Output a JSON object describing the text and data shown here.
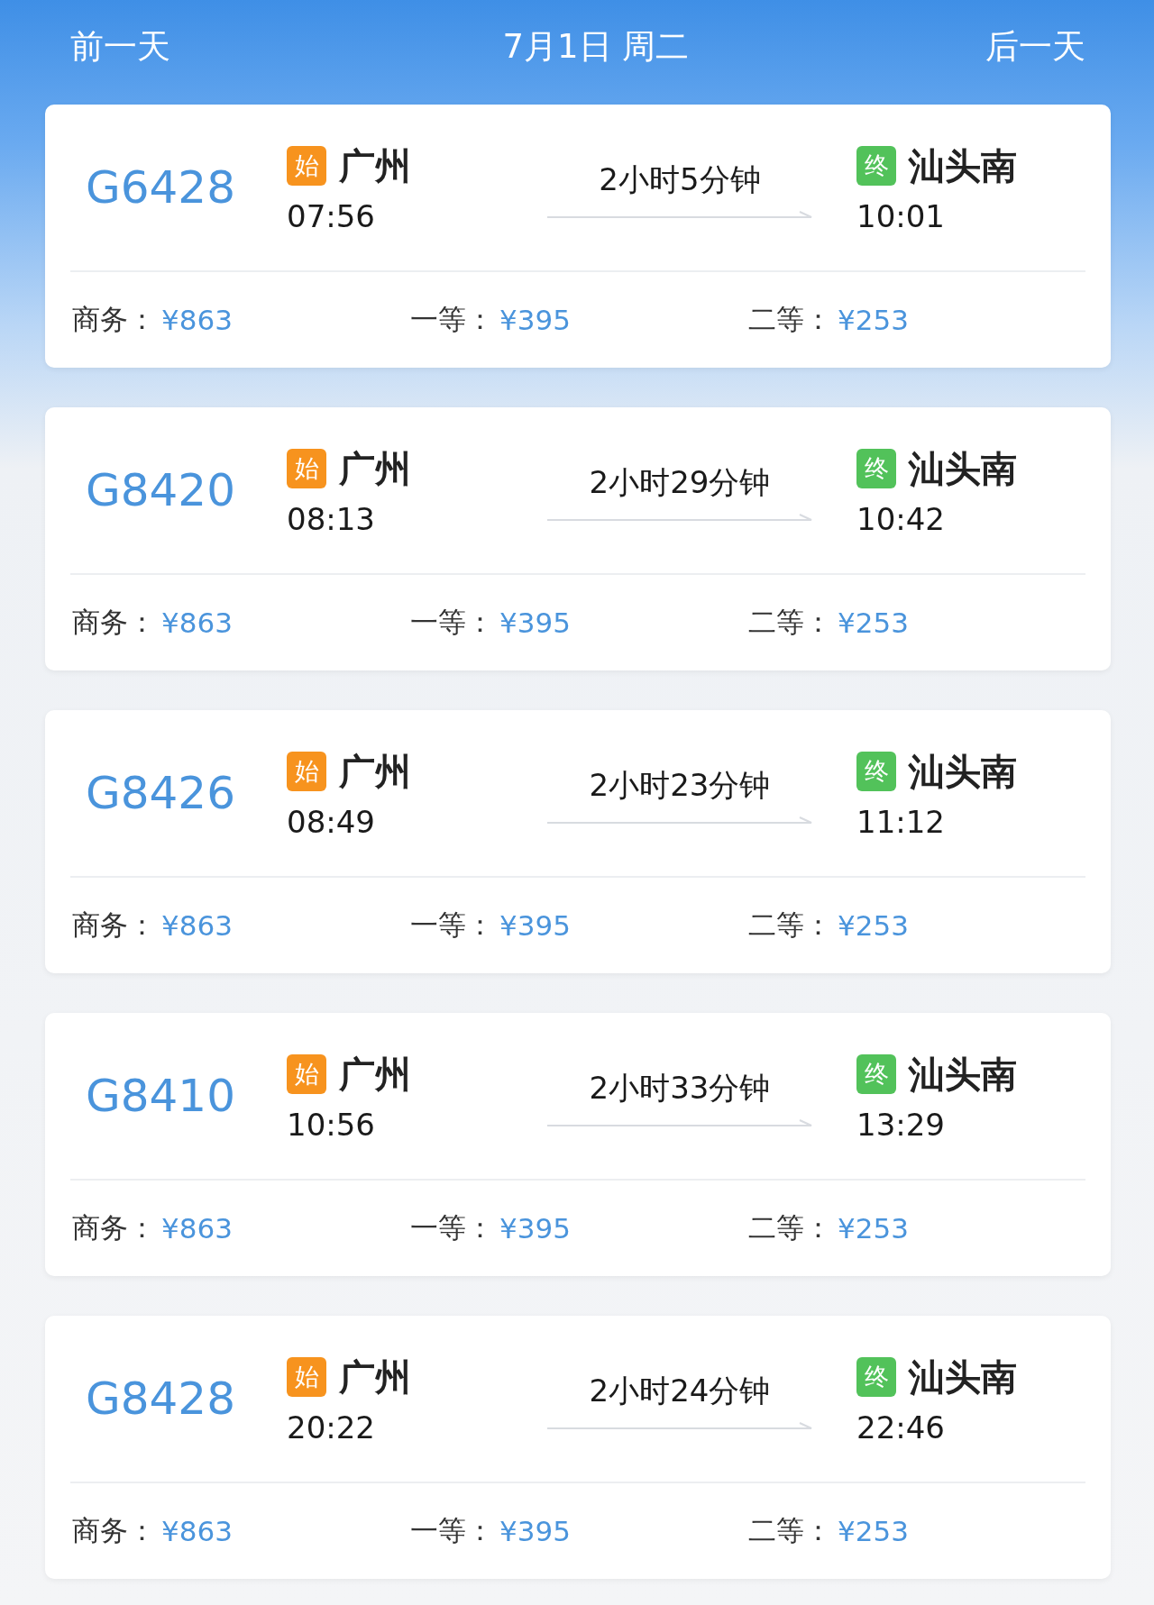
{
  "header": {
    "prev": "前一天",
    "date": "7月1日 周二",
    "next": "后一天"
  },
  "trains": [
    {
      "number": "G6428",
      "depart": {
        "badge": "始",
        "station": "广州",
        "time": "07:56"
      },
      "duration": "2小时5分钟",
      "arrive": {
        "badge": "终",
        "station": "汕头南",
        "time": "10:01"
      },
      "prices": [
        {
          "label": "商务：",
          "price": "¥863"
        },
        {
          "label": "一等：",
          "price": "¥395"
        },
        {
          "label": "二等：",
          "price": "¥253"
        }
      ]
    },
    {
      "number": "G8420",
      "depart": {
        "badge": "始",
        "station": "广州",
        "time": "08:13"
      },
      "duration": "2小时29分钟",
      "arrive": {
        "badge": "终",
        "station": "汕头南",
        "time": "10:42"
      },
      "prices": [
        {
          "label": "商务：",
          "price": "¥863"
        },
        {
          "label": "一等：",
          "price": "¥395"
        },
        {
          "label": "二等：",
          "price": "¥253"
        }
      ]
    },
    {
      "number": "G8426",
      "depart": {
        "badge": "始",
        "station": "广州",
        "time": "08:49"
      },
      "duration": "2小时23分钟",
      "arrive": {
        "badge": "终",
        "station": "汕头南",
        "time": "11:12"
      },
      "prices": [
        {
          "label": "商务：",
          "price": "¥863"
        },
        {
          "label": "一等：",
          "price": "¥395"
        },
        {
          "label": "二等：",
          "price": "¥253"
        }
      ]
    },
    {
      "number": "G8410",
      "depart": {
        "badge": "始",
        "station": "广州",
        "time": "10:56"
      },
      "duration": "2小时33分钟",
      "arrive": {
        "badge": "终",
        "station": "汕头南",
        "time": "13:29"
      },
      "prices": [
        {
          "label": "商务：",
          "price": "¥863"
        },
        {
          "label": "一等：",
          "price": "¥395"
        },
        {
          "label": "二等：",
          "price": "¥253"
        }
      ]
    },
    {
      "number": "G8428",
      "depart": {
        "badge": "始",
        "station": "广州",
        "time": "20:22"
      },
      "duration": "2小时24分钟",
      "arrive": {
        "badge": "终",
        "station": "汕头南",
        "time": "22:46"
      },
      "prices": [
        {
          "label": "商务：",
          "price": "¥863"
        },
        {
          "label": "一等：",
          "price": "¥395"
        },
        {
          "label": "二等：",
          "price": "¥253"
        }
      ]
    }
  ]
}
